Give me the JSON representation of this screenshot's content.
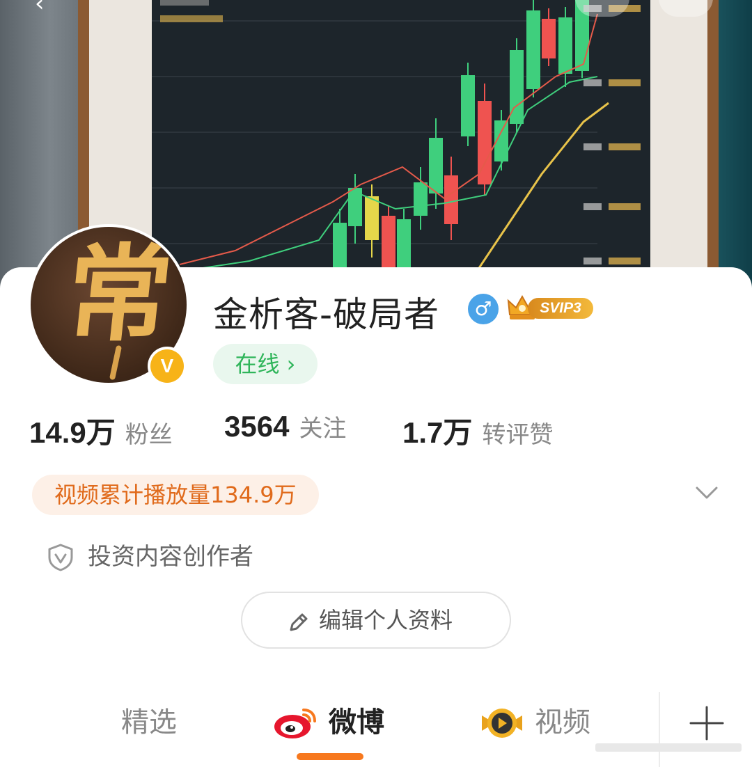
{
  "profile": {
    "username": "金析客-破局者",
    "gender_icon": "♂",
    "vip_label": "SVIP3",
    "verified_mark": "V",
    "status": "在线 ›",
    "avatar_glyph": "常"
  },
  "stats": [
    {
      "value": "14.9万",
      "label": "粉丝"
    },
    {
      "value": "3564",
      "label": "关注"
    },
    {
      "value": "1.7万",
      "label": "转评赞"
    }
  ],
  "video_plays": "视频累计播放量134.9万",
  "verification": "投资内容创作者",
  "edit_button": "编辑个人资料",
  "tabs": [
    {
      "label": "精选",
      "active": false
    },
    {
      "label": "微博",
      "active": true
    },
    {
      "label": "视频",
      "active": false
    }
  ],
  "colors": {
    "accent": "#f7781e",
    "online_green": "#2fb55a",
    "plays_orange": "#e06a1b",
    "gender_blue": "#4aa3e8",
    "verified_gold": "#f7b318"
  },
  "icons": {
    "back": "back-arrow-icon",
    "search": "search-icon",
    "more": "more-icon",
    "gender": "male-icon",
    "crown": "crown-icon",
    "expand": "chevron-down-icon",
    "shield": "shield-v-icon",
    "edit": "pencil-icon",
    "weibo": "weibo-logo-icon",
    "video": "video-play-icon",
    "add": "plus-icon"
  }
}
